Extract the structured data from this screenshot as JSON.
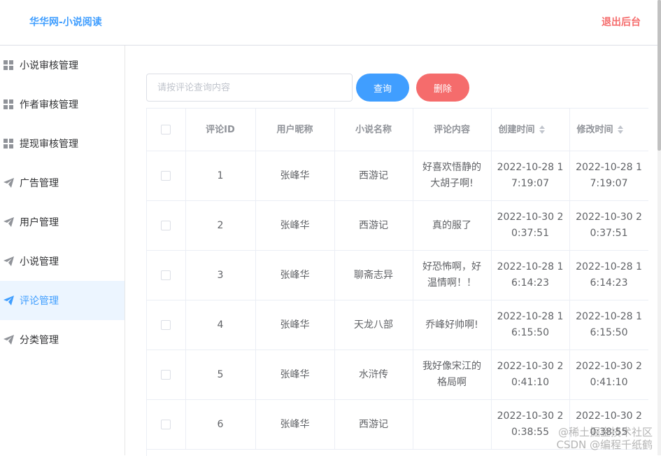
{
  "header": {
    "brand": "华华网-小说阅读",
    "logout": "退出后台"
  },
  "sidebar": {
    "items": [
      {
        "label": "小说审核管理",
        "icon": "grid-icon"
      },
      {
        "label": "作者审核管理",
        "icon": "grid-icon"
      },
      {
        "label": "提现审核管理",
        "icon": "grid-icon"
      },
      {
        "label": "广告管理",
        "icon": "paper-plane-icon"
      },
      {
        "label": "用户管理",
        "icon": "paper-plane-icon"
      },
      {
        "label": "小说管理",
        "icon": "paper-plane-icon"
      },
      {
        "label": "评论管理",
        "icon": "paper-plane-icon",
        "active": true
      },
      {
        "label": "分类管理",
        "icon": "paper-plane-icon"
      }
    ]
  },
  "search": {
    "placeholder": "请按评论查询内容",
    "value": ""
  },
  "buttons": {
    "query": "查询",
    "delete": "删除"
  },
  "colors": {
    "primary": "#409eff",
    "danger": "#f56c6c",
    "active_bg": "#ecf5ff"
  },
  "table": {
    "headers": {
      "id": "评论ID",
      "user": "用户昵称",
      "novel": "小说名称",
      "content": "评论内容",
      "created": "创建时间",
      "modified": "修改时间"
    },
    "rows": [
      {
        "id": "1",
        "user": "张峰华",
        "novel": "西游记",
        "content": "好喜欢悟静的大胡子啊!",
        "created": "2022-10-28 17:19:07",
        "modified": "2022-10-28 17:19:07"
      },
      {
        "id": "2",
        "user": "张峰华",
        "novel": "西游记",
        "content": "真的服了",
        "created": "2022-10-30 20:37:51",
        "modified": "2022-10-30 20:37:51"
      },
      {
        "id": "3",
        "user": "张峰华",
        "novel": "聊斋志异",
        "content": "好恐怖啊，好温情啊！！",
        "created": "2022-10-28 16:14:23",
        "modified": "2022-10-28 16:14:23"
      },
      {
        "id": "4",
        "user": "张峰华",
        "novel": "天龙八部",
        "content": "乔峰好帅啊!",
        "created": "2022-10-28 16:15:50",
        "modified": "2022-10-28 16:15:50"
      },
      {
        "id": "5",
        "user": "张峰华",
        "novel": "水浒传",
        "content": "我好像宋江的格局啊",
        "created": "2022-10-30 20:41:10",
        "modified": "2022-10-30 20:41:10"
      },
      {
        "id": "6",
        "user": "张峰华",
        "novel": "西游记",
        "content": "",
        "created": "2022-10-30 20:38:55",
        "modified": "2022-10-30 20:38:55"
      }
    ]
  },
  "watermark": {
    "line1": "@稀土掘金技术社区",
    "line2": "CSDN @编程千纸鹤"
  }
}
